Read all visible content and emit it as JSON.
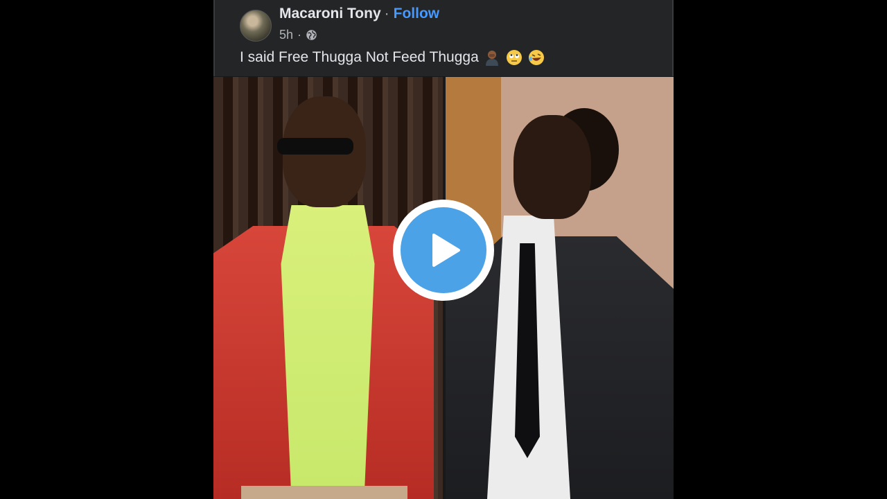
{
  "post": {
    "author": "Macaroni Tony",
    "separator": "·",
    "follow_label": "Follow",
    "time": "5h",
    "meta_separator": "·",
    "text": "I said Free Thugga Not Feed Thugga",
    "emojis": [
      "man-facepalming-emoji",
      "face-with-rolling-eyes-emoji",
      "rolling-on-the-floor-laughing-emoji"
    ]
  },
  "colors": {
    "follow": "#4599ff",
    "header_bg": "#242526",
    "play_fill": "#4ca2e6"
  },
  "icons": {
    "visibility": "globe-icon",
    "player": "play-icon"
  }
}
